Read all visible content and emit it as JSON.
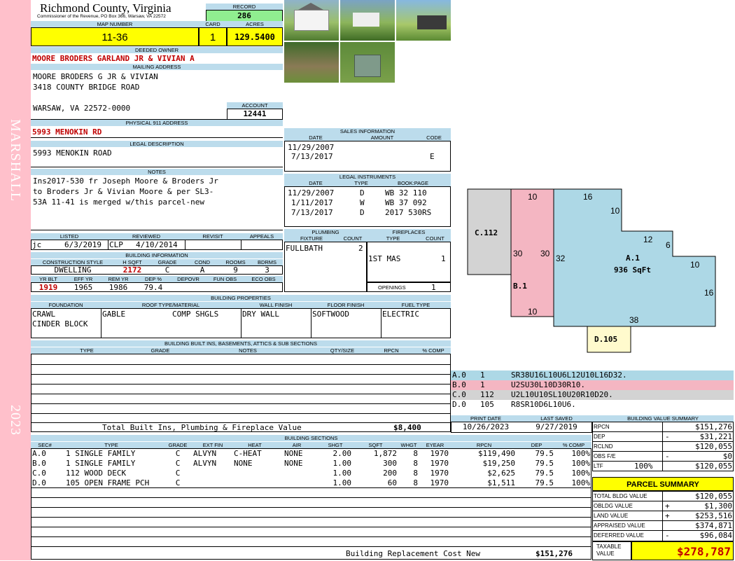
{
  "sidebar": {
    "district": "MARSHALL",
    "year": "2023"
  },
  "header": {
    "county": "Richmond County, Virginia",
    "commissioner": "Commissioner of the Revenue, PO Box 366, Warsaw, VA 22572"
  },
  "record": {
    "label": "RECORD",
    "value": "286"
  },
  "map": {
    "map_label": "MAP NUMBER",
    "map_value": "11-36",
    "card_label": "CARD",
    "card_value": "1",
    "acres_label": "ACRES",
    "acres_value": "129.5400"
  },
  "owner": {
    "label": "DEEDED OWNER",
    "value": "MOORE BRODERS GARLAND JR & VIVIAN A"
  },
  "mailing": {
    "label": "MAILING ADDRESS",
    "line1": "MOORE BRODERS G JR & VIVIAN",
    "line2": "3418 COUNTY BRIDGE ROAD",
    "line3": "WARSAW, VA 22572-0000"
  },
  "account": {
    "label": "ACCOUNT",
    "value": "12441"
  },
  "physical": {
    "label": "PHYSICAL 911 ADDRESS",
    "value": "5993 MENOKIN RD"
  },
  "legal": {
    "label": "LEGAL DESCRIPTION",
    "value": "5993 MENOKIN ROAD"
  },
  "notes": {
    "label": "NOTES",
    "line1": "Ins2017-530 fr Joseph Moore & Broders Jr",
    "line2": "to Broders Jr & Vivian Moore & per SL3-",
    "line3": "53A 11-41 is merged w/this parcel-new"
  },
  "listed": {
    "listed_label": "LISTED",
    "reviewed_label": "REVIEWED",
    "revisit_label": "REVISIT",
    "appeals_label": "APPEALS",
    "listed_by": "jc",
    "listed_date": "6/3/2019",
    "reviewed_by": "CLP",
    "reviewed_date": "4/10/2014"
  },
  "building_info": {
    "label": "BUILDING INFORMATION",
    "h_style": "CONSTRUCTION STYLE",
    "h_sqft": "H SQFT",
    "h_grade": "GRADE",
    "h_cond": "COND",
    "h_rooms": "ROOMS",
    "h_bdrms": "BDRMS",
    "style": "DWELLING",
    "sqft": "2172",
    "grade": "C",
    "cond": "A",
    "rooms": "9",
    "bdrms": "3",
    "h_yrblt": "YR BLT",
    "h_effyr": "EFF YR",
    "h_remyr": "REM YR",
    "h_dep": "DEP %",
    "h_depovr": "DEPOVR",
    "h_funobs": "FUN OBS",
    "h_ecoobs": "ECO OBS",
    "yrblt": "1919",
    "effyr": "1965",
    "remyr": "1986",
    "dep": "79.4"
  },
  "sales": {
    "label": "SALES INFORMATION",
    "h_date": "DATE",
    "h_amount": "AMOUNT",
    "h_code": "CODE",
    "rows": [
      {
        "date": "11/29/2007",
        "amount": "",
        "code": ""
      },
      {
        "date": "7/13/2017",
        "amount": "",
        "code": "E"
      }
    ]
  },
  "instruments": {
    "label": "LEGAL INSTRUMENTS",
    "h_date": "DATE",
    "h_type": "TYPE",
    "h_book": "BOOK:PAGE",
    "rows": [
      {
        "date": "11/29/2007",
        "type": "D",
        "book": "WB 32 110"
      },
      {
        "date": "1/11/2017",
        "type": "W",
        "book": "WB 37 092"
      },
      {
        "date": "7/13/2017",
        "type": "D",
        "book": "2017 530RS"
      }
    ]
  },
  "plumbing": {
    "label": "PLUMBING",
    "h_fixture": "FIXTURE",
    "h_count": "COUNT",
    "fixture": "FULLBATH",
    "count": "2"
  },
  "fireplaces": {
    "label": "FIREPLACES",
    "h_type": "TYPE",
    "h_count": "COUNT",
    "type": "1ST MAS",
    "count": "1",
    "openings_label": "OPENINGS",
    "openings": "1"
  },
  "properties": {
    "label": "BUILDING PROPERTIES",
    "h_foundation": "FOUNDATION",
    "h_roof": "ROOF TYPE/MATERIAL",
    "h_wall": "WALL FINISH",
    "h_floor": "FLOOR FINISH",
    "h_fuel": "FUEL TYPE",
    "foundation1": "CRAWL",
    "foundation2": "CINDER BLOCK",
    "roof_type": "GABLE",
    "roof_mat": "COMP SHGLS",
    "wall": "DRY WALL",
    "floor": "SOFTWOOD",
    "fuel": "ELECTRIC"
  },
  "builtins": {
    "label": "BUILDING BUILT INS, BASEMENTS, ATTICS & SUB SECTIONS",
    "h_type": "TYPE",
    "h_grade": "GRADE",
    "h_notes": "NOTES",
    "h_qty": "QTY/SIZE",
    "h_rpcn": "RPCN",
    "h_comp": "% COMP",
    "total_label": "Total Built Ins, Plumbing & Fireplace Value",
    "total_value": "$8,400"
  },
  "sketch": {
    "labels": [
      {
        "text": "C.112",
        "section": "C"
      },
      {
        "text": "B.1",
        "section": "B"
      },
      {
        "text": "A.1",
        "section": "A"
      },
      {
        "text": "936 SqFt",
        "section": "A"
      },
      {
        "text": "D.105",
        "section": "D"
      }
    ],
    "dims": [
      "10",
      "16",
      "10",
      "12",
      "6",
      "10",
      "16",
      "38",
      "10",
      "30",
      "30",
      "32"
    ],
    "colors": {
      "A": "#add8e6",
      "B": "#f4b6c2",
      "C": "#d3d3d3",
      "D": "#fffacd"
    }
  },
  "traverse": [
    {
      "sec": "A.0",
      "num": "1",
      "code": "SR38U16L10U6L12U10L16D32.",
      "color": "#add8e6"
    },
    {
      "sec": "B.0",
      "num": "1",
      "code": "U2SU30L10D30R10.",
      "color": "#f4b6c2"
    },
    {
      "sec": "C.0",
      "num": "112",
      "code": "U2L10U10SL10U20R10D20.",
      "color": "#d3d3d3"
    },
    {
      "sec": "D.0",
      "num": "105",
      "code": "R8SR10D6L10U6.",
      "color": "#ffffff"
    }
  ],
  "print": {
    "print_label": "PRINT DATE",
    "saved_label": "LAST SAVED",
    "print_date": "10/26/2023",
    "saved_date": "9/27/2019"
  },
  "bvs": {
    "label": "BUILDING VALUE SUMMARY",
    "rows": [
      {
        "name": "RPCN",
        "pct": "",
        "sign": "",
        "value": "$151,276"
      },
      {
        "name": "DEP",
        "pct": "",
        "sign": "-",
        "value": "$31,221"
      },
      {
        "name": "RCLND",
        "pct": "",
        "sign": "",
        "value": "$120,055"
      },
      {
        "name": "OBS F/E",
        "pct": "",
        "sign": "-",
        "value": "$0"
      },
      {
        "name": "LTF",
        "pct": "100%",
        "sign": "",
        "value": "$120,055"
      }
    ]
  },
  "sections": {
    "label": "BUILDING SECTIONS",
    "headers": [
      "SEC#",
      "TYPE",
      "GRADE",
      "EXT FIN",
      "HEAT",
      "AIR",
      "SHGT",
      "SQFT",
      "WHGT",
      "EYEAR",
      "RPCN",
      "DEP",
      "% COMP"
    ],
    "rows": [
      {
        "sec": "A.0",
        "type": "1 SINGLE FAMILY",
        "grade": "C",
        "ext": "ALVYN",
        "heat": "C-HEAT",
        "air": "NONE",
        "shgt": "2.00",
        "sqft": "1,872",
        "whgt": "8",
        "eyear": "1970",
        "rpcn": "$119,490",
        "dep": "79.5",
        "comp": "100%"
      },
      {
        "sec": "B.0",
        "type": "1 SINGLE FAMILY",
        "grade": "C",
        "ext": "ALVYN",
        "heat": "NONE",
        "air": "NONE",
        "shgt": "1.00",
        "sqft": "300",
        "whgt": "8",
        "eyear": "1970",
        "rpcn": "$19,250",
        "dep": "79.5",
        "comp": "100%"
      },
      {
        "sec": "C.0",
        "type": "112 WOOD DECK",
        "grade": "C",
        "ext": "",
        "heat": "",
        "air": "",
        "shgt": "1.00",
        "sqft": "200",
        "whgt": "8",
        "eyear": "1970",
        "rpcn": "$2,625",
        "dep": "79.5",
        "comp": "100%"
      },
      {
        "sec": "D.0",
        "type": "105 OPEN FRAME PCH",
        "grade": "C",
        "ext": "",
        "heat": "",
        "air": "",
        "shgt": "1.00",
        "sqft": "60",
        "whgt": "8",
        "eyear": "1970",
        "rpcn": "$1,511",
        "dep": "79.5",
        "comp": "100%"
      }
    ],
    "total_label": "Building Replacement Cost New",
    "total_value": "$151,276"
  },
  "parcel": {
    "label": "PARCEL SUMMARY",
    "rows": [
      {
        "name": "TOTAL BLDG VALUE",
        "sign": "",
        "value": "$120,055"
      },
      {
        "name": "OBLDG VALUE",
        "sign": "+",
        "value": "$1,300"
      },
      {
        "name": "LAND VALUE",
        "sign": "+",
        "value": "$253,516"
      },
      {
        "name": "APPRAISED VALUE",
        "sign": "",
        "value": "$374,871"
      },
      {
        "name": "DEFERRED VALUE",
        "sign": "-",
        "value": "$96,084"
      }
    ],
    "taxable_label": "TAXABLE VALUE",
    "taxable_value": "$278,787"
  }
}
